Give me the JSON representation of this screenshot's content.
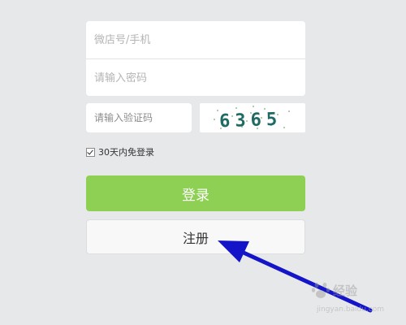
{
  "login_form": {
    "phone_placeholder": "微店号/手机",
    "password_placeholder": "请输入密码",
    "captcha_placeholder": "请输入验证码",
    "captcha_code": "6365",
    "remember_label": "30天内免登录",
    "remember_checked": true,
    "login_label": "登录",
    "register_label": "注册"
  },
  "watermark": {
    "text": "经验",
    "url": "jingyan.baidu.com"
  },
  "colors": {
    "background": "#e7e8ea",
    "login_button": "#8ed054",
    "register_button": "#f8f8f8",
    "arrow": "#1414c8",
    "captcha_text": "#1f6b63"
  }
}
